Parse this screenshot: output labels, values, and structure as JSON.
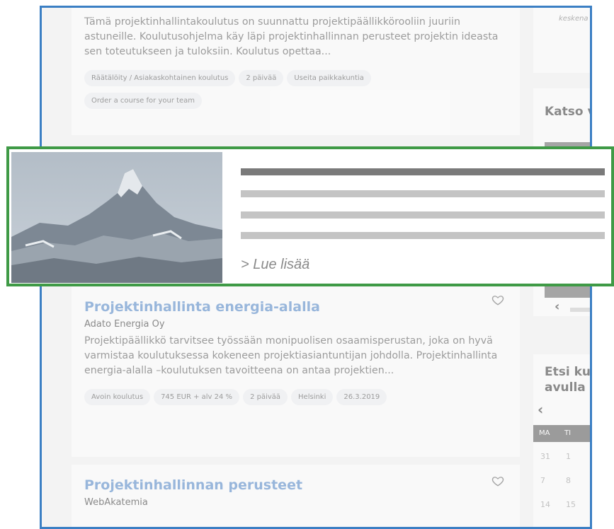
{
  "courses": [
    {
      "description": "Tämä projektinhallintakoulutus on suunnattu projektipäällikkörooliin juuriin astuneille. Koulutusohjelma käy läpi projektinhallinnan perusteet projektin ideasta sen toteutukseen ja tuloksiin. Koulutus opettaa...",
      "tags": [
        "Räätälöity / Asiakaskohtainen koulutus",
        "2 päivää",
        "Useita paikkakuntia",
        "Order a course for your team"
      ]
    },
    {
      "title": "Projektinhallinta energia-alalla",
      "organizer": "Adato Energia Oy",
      "description": "Projektipäällikkö tarvitsee työssään monipuolisen osaamisperustan, joka on hyvä varmistaa koulutuksessa kokeneen projektiasiantuntijan johdolla. Projektinhallinta energia-alalla –koulutuksen tavoitteena on antaa projektien...",
      "tags": [
        "Avoin koulutus",
        "745 EUR + alv 24 %",
        "2 päivää",
        "Helsinki",
        "26.3.2019"
      ]
    },
    {
      "title": "Projektinhallinnan perusteet",
      "organizer": "WebAkatemia"
    }
  ],
  "sidebar": {
    "status_text": "keskena",
    "watch_heading": "Katso v",
    "search_heading_line1": "Etsi ku",
    "search_heading_line2": "avulla",
    "calendar": {
      "weekdays": [
        "MA",
        "TI"
      ],
      "rows": [
        [
          "31",
          "1"
        ],
        [
          "7",
          "8"
        ],
        [
          "14",
          "15"
        ]
      ]
    }
  },
  "overlay_card": {
    "read_more": "> Lue lisää",
    "image_icon": "mountain-image",
    "colors": {
      "frame": "#3f9a46",
      "placeholder_dark": "#7a7a7a",
      "placeholder_light": "#c4c4c4"
    }
  },
  "colors": {
    "page_frame": "#3b7fc4",
    "title_link": "#4f86c9"
  }
}
